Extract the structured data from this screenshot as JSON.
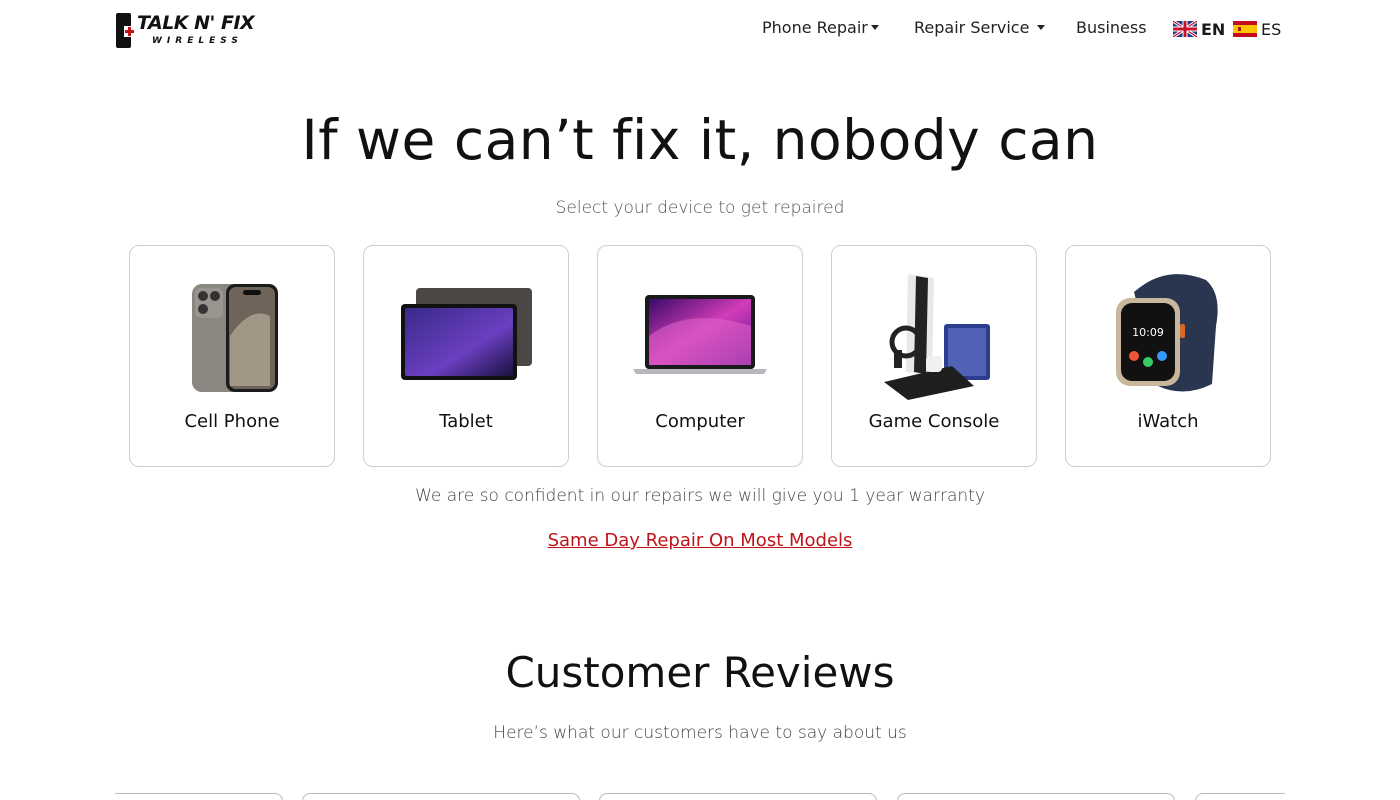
{
  "brand": {
    "name_line1": "TALK N' FIX",
    "name_line2": "WIRELESS",
    "colors": {
      "accent": "#c0141a",
      "text": "#111111"
    }
  },
  "nav": {
    "phone_repair": "Phone Repair",
    "repair_service": "Repair Service",
    "business": "Business",
    "lang_en": "EN",
    "lang_es": "ES"
  },
  "hero": {
    "title": "If we can’t fix it, nobody can",
    "subtitle": "Select your device to get repaired"
  },
  "devices": [
    {
      "label": "Cell Phone",
      "icon": "phone-icon"
    },
    {
      "label": "Tablet",
      "icon": "tablet-icon"
    },
    {
      "label": "Computer",
      "icon": "laptop-icon"
    },
    {
      "label": "Game Console",
      "icon": "game-console-icon"
    },
    {
      "label": "iWatch",
      "icon": "watch-icon"
    }
  ],
  "warranty": "We are so confident in our repairs we will give you 1 year warranty",
  "same_day_link": "Same Day Repair On Most Models",
  "reviews": {
    "title": "Customer Reviews",
    "subtitle": "Here’s what our customers have to say about us"
  }
}
